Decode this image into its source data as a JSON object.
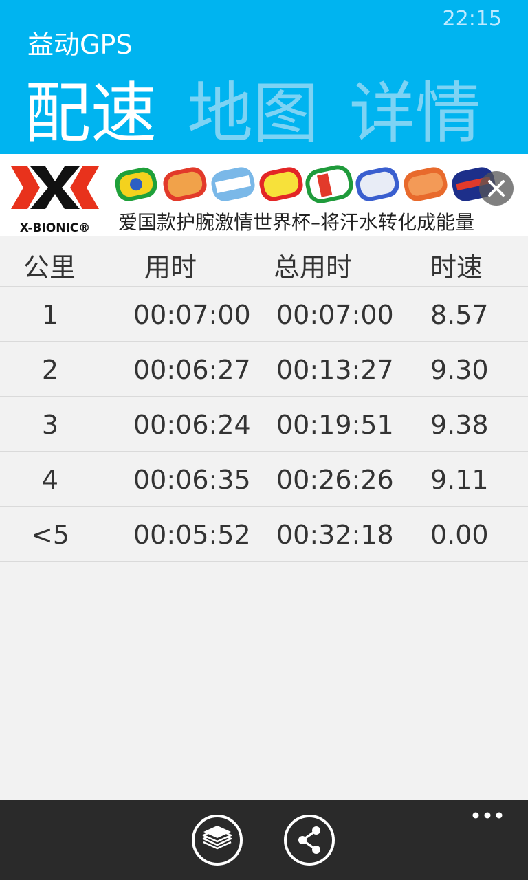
{
  "status_bar": {
    "time": "22:15"
  },
  "app": {
    "title": "益动GPS"
  },
  "pivot": {
    "items": [
      "配速",
      "地图",
      "详情"
    ],
    "active_index": 0
  },
  "ad": {
    "brand": "X-BIONIC®",
    "text": "爱国款护腕激情世界杯–将汗水转化成能量",
    "brand_colors": [
      "#e8321c",
      "#111111"
    ],
    "wristband_colors": [
      "#1fa03a",
      "#e23a2a",
      "#7ab8e8",
      "#e32626",
      "#ffffff",
      "#3a5fcf",
      "#e86a2c",
      "#1d2f8a"
    ],
    "close_icon": "close-icon"
  },
  "table": {
    "headers": [
      "公里",
      "用时",
      "总用时",
      "时速"
    ],
    "rows": [
      [
        "1",
        "00:07:00",
        "00:07:00",
        "8.57"
      ],
      [
        "2",
        "00:06:27",
        "00:13:27",
        "9.30"
      ],
      [
        "3",
        "00:06:24",
        "00:19:51",
        "9.38"
      ],
      [
        "4",
        "00:06:35",
        "00:26:26",
        "9.11"
      ],
      [
        "<5",
        "00:05:52",
        "00:32:18",
        "0.00"
      ]
    ]
  },
  "app_bar": {
    "buttons": [
      {
        "icon": "layers-icon"
      },
      {
        "icon": "share-icon"
      }
    ],
    "more_icon": "more-icon"
  },
  "colors": {
    "accent": "#00b4f0",
    "app_bar": "#2a2a2a",
    "background": "#f2f2f2"
  }
}
